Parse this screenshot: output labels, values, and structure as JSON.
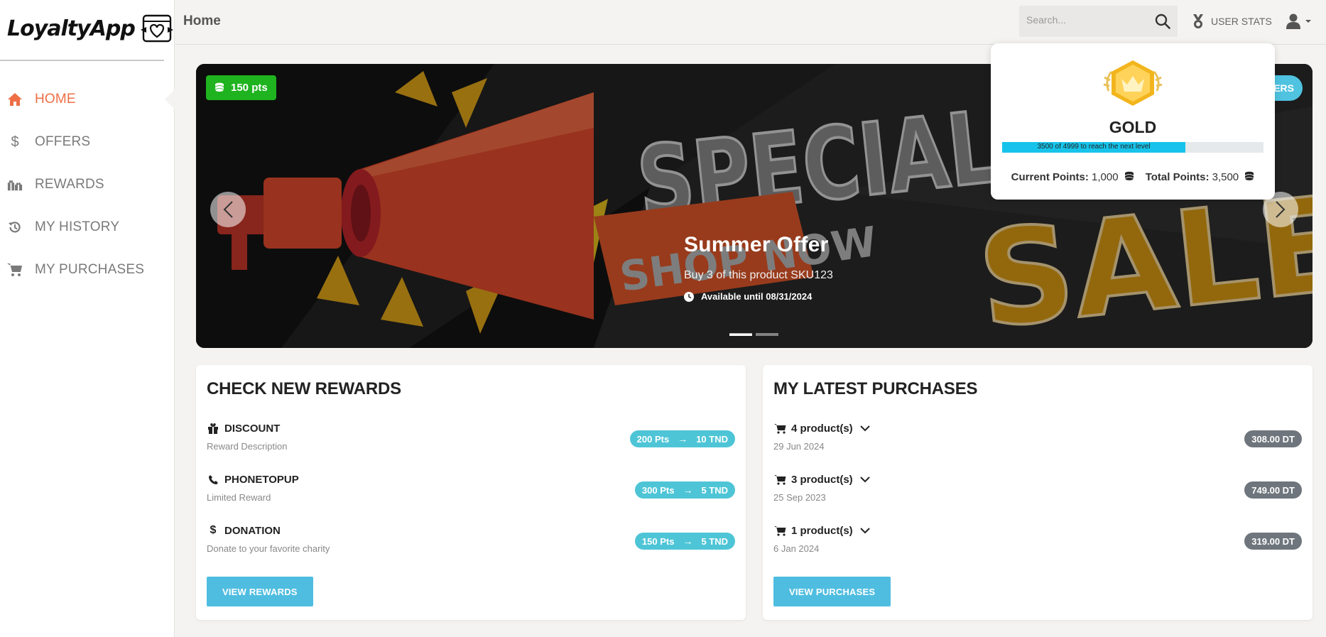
{
  "app": {
    "logo_text": "LoyaltyApp"
  },
  "sidebar": {
    "items": [
      {
        "label": "HOME",
        "icon": "home-icon",
        "active": true
      },
      {
        "label": "OFFERS",
        "icon": "dollar-icon",
        "active": false
      },
      {
        "label": "REWARDS",
        "icon": "gifts-icon",
        "active": false
      },
      {
        "label": "MY HISTORY",
        "icon": "history-icon",
        "active": false
      },
      {
        "label": "MY PURCHASES",
        "icon": "cart-icon",
        "active": false
      }
    ]
  },
  "header": {
    "title": "Home",
    "search_placeholder": "Search...",
    "user_stats_label": "USER STATS"
  },
  "carousel": {
    "points_badge": "150 pts",
    "offers_button": "ERS",
    "caption_title": "Summer Offer",
    "caption_subtitle": "Buy 3 of this product SKU123",
    "caption_availability": "Available until 08/31/2024",
    "banner_text_1": "SPECIAL",
    "banner_text_2": "SALE",
    "banner_text_3": "SHOP NOW",
    "slides": 2,
    "active_slide": 0
  },
  "user_stats_popover": {
    "level": "GOLD",
    "progress_text": "3500 of 4999 to reach the next level",
    "progress_fraction": 0.7,
    "current_points_label": "Current Points:",
    "current_points_value": "1,000",
    "total_points_label": "Total Points:",
    "total_points_value": "3,500"
  },
  "rewards_card": {
    "title": "CHECK NEW REWARDS",
    "items": [
      {
        "name": "DISCOUNT",
        "icon": "gift-icon",
        "description": "Reward Description",
        "points": "200 Pts",
        "value": "10 TND"
      },
      {
        "name": "PHONETOPUP",
        "icon": "phone-icon",
        "description": "Limited Reward",
        "points": "300 Pts",
        "value": "5 TND"
      },
      {
        "name": "DONATION",
        "icon": "dollar-icon",
        "description": "Donate to your favorite charity",
        "points": "150 Pts",
        "value": "5 TND"
      }
    ],
    "button_label": "VIEW REWARDS"
  },
  "purchases_card": {
    "title": "MY LATEST PURCHASES",
    "items": [
      {
        "products": "4 product(s)",
        "date": "29 Jun 2024",
        "amount": "308.00 DT"
      },
      {
        "products": "3 product(s)",
        "date": "25 Sep 2023",
        "amount": "749.00 DT"
      },
      {
        "products": "1 product(s)",
        "date": "6 Jan 2024",
        "amount": "319.00 DT"
      }
    ],
    "button_label": "VIEW PURCHASES"
  },
  "colors": {
    "accent": "#ee6f45",
    "points_green": "#1fb31f",
    "pill_teal": "#4ec5d6",
    "button_blue": "#4fbde0",
    "price_grey": "#6e757c",
    "progress_cyan": "#17c3ea"
  }
}
